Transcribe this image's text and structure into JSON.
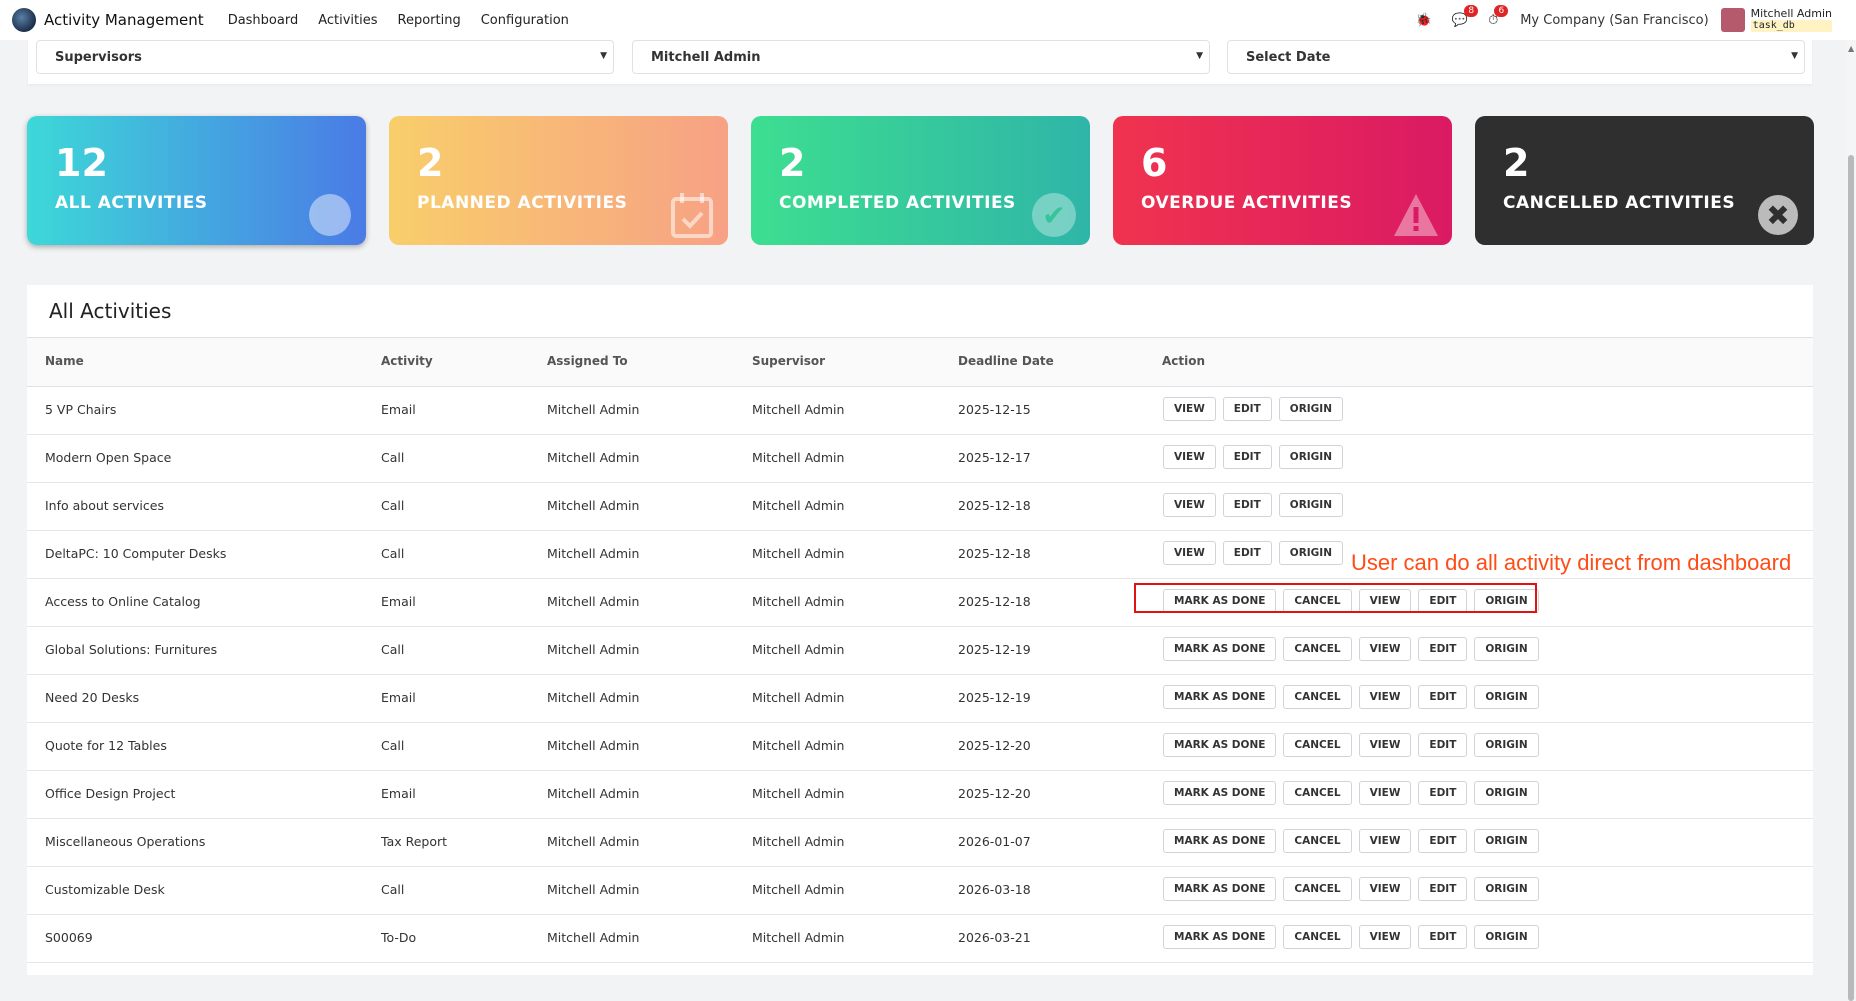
{
  "navbar": {
    "app_title": "Activity Management",
    "menu": [
      "Dashboard",
      "Activities",
      "Reporting",
      "Configuration"
    ],
    "chat_badge": "8",
    "clock_badge": "6",
    "company": "My Company (San Francisco)",
    "user_name": "Mitchell Admin",
    "user_db": "task_db"
  },
  "filters": {
    "supervisor": "Supervisors",
    "user": "Mitchell Admin",
    "date": "Select Date"
  },
  "cards": [
    {
      "count": "12",
      "label": "ALL ACTIVITIES",
      "icon": "globe-icon"
    },
    {
      "count": "2",
      "label": "PLANNED ACTIVITIES",
      "icon": "calendar-check-icon"
    },
    {
      "count": "2",
      "label": "COMPLETED ACTIVITIES",
      "icon": "check-circle-icon"
    },
    {
      "count": "6",
      "label": "OVERDUE ACTIVITIES",
      "icon": "warning-icon"
    },
    {
      "count": "2",
      "label": "CANCELLED ACTIVITIES",
      "icon": "x-circle-icon"
    }
  ],
  "table": {
    "title": "All Activities",
    "columns": [
      "Name",
      "Activity",
      "Assigned To",
      "Supervisor",
      "Deadline Date",
      "Action"
    ],
    "rows": [
      {
        "name": "5 VP Chairs",
        "activity": "Email",
        "assigned": "Mitchell Admin",
        "supervisor": "Mitchell Admin",
        "deadline": "2025-12-15",
        "actions": [
          "VIEW",
          "EDIT",
          "ORIGIN"
        ]
      },
      {
        "name": "Modern Open Space",
        "activity": "Call",
        "assigned": "Mitchell Admin",
        "supervisor": "Mitchell Admin",
        "deadline": "2025-12-17",
        "actions": [
          "VIEW",
          "EDIT",
          "ORIGIN"
        ]
      },
      {
        "name": "Info about services",
        "activity": "Call",
        "assigned": "Mitchell Admin",
        "supervisor": "Mitchell Admin",
        "deadline": "2025-12-18",
        "actions": [
          "VIEW",
          "EDIT",
          "ORIGIN"
        ]
      },
      {
        "name": "DeltaPC: 10 Computer Desks",
        "activity": "Call",
        "assigned": "Mitchell Admin",
        "supervisor": "Mitchell Admin",
        "deadline": "2025-12-18",
        "actions": [
          "VIEW",
          "EDIT",
          "ORIGIN"
        ]
      },
      {
        "name": "Access to Online Catalog",
        "activity": "Email",
        "assigned": "Mitchell Admin",
        "supervisor": "Mitchell Admin",
        "deadline": "2025-12-18",
        "actions": [
          "MARK AS DONE",
          "CANCEL",
          "VIEW",
          "EDIT",
          "ORIGIN"
        ]
      },
      {
        "name": "Global Solutions: Furnitures",
        "activity": "Call",
        "assigned": "Mitchell Admin",
        "supervisor": "Mitchell Admin",
        "deadline": "2025-12-19",
        "actions": [
          "MARK AS DONE",
          "CANCEL",
          "VIEW",
          "EDIT",
          "ORIGIN"
        ]
      },
      {
        "name": "Need 20 Desks",
        "activity": "Email",
        "assigned": "Mitchell Admin",
        "supervisor": "Mitchell Admin",
        "deadline": "2025-12-19",
        "actions": [
          "MARK AS DONE",
          "CANCEL",
          "VIEW",
          "EDIT",
          "ORIGIN"
        ]
      },
      {
        "name": "Quote for 12 Tables",
        "activity": "Call",
        "assigned": "Mitchell Admin",
        "supervisor": "Mitchell Admin",
        "deadline": "2025-12-20",
        "actions": [
          "MARK AS DONE",
          "CANCEL",
          "VIEW",
          "EDIT",
          "ORIGIN"
        ]
      },
      {
        "name": "Office Design Project",
        "activity": "Email",
        "assigned": "Mitchell Admin",
        "supervisor": "Mitchell Admin",
        "deadline": "2025-12-20",
        "actions": [
          "MARK AS DONE",
          "CANCEL",
          "VIEW",
          "EDIT",
          "ORIGIN"
        ]
      },
      {
        "name": "Miscellaneous Operations",
        "activity": "Tax Report",
        "assigned": "Mitchell Admin",
        "supervisor": "Mitchell Admin",
        "deadline": "2026-01-07",
        "actions": [
          "MARK AS DONE",
          "CANCEL",
          "VIEW",
          "EDIT",
          "ORIGIN"
        ]
      },
      {
        "name": "Customizable Desk",
        "activity": "Call",
        "assigned": "Mitchell Admin",
        "supervisor": "Mitchell Admin",
        "deadline": "2026-03-18",
        "actions": [
          "MARK AS DONE",
          "CANCEL",
          "VIEW",
          "EDIT",
          "ORIGIN"
        ]
      },
      {
        "name": "S00069",
        "activity": "To-Do",
        "assigned": "Mitchell Admin",
        "supervisor": "Mitchell Admin",
        "deadline": "2026-03-21",
        "actions": [
          "MARK AS DONE",
          "CANCEL",
          "VIEW",
          "EDIT",
          "ORIGIN"
        ]
      }
    ]
  },
  "annotation": {
    "text": "User can do all activity direct from dashboard",
    "color": "#ff4c16"
  }
}
